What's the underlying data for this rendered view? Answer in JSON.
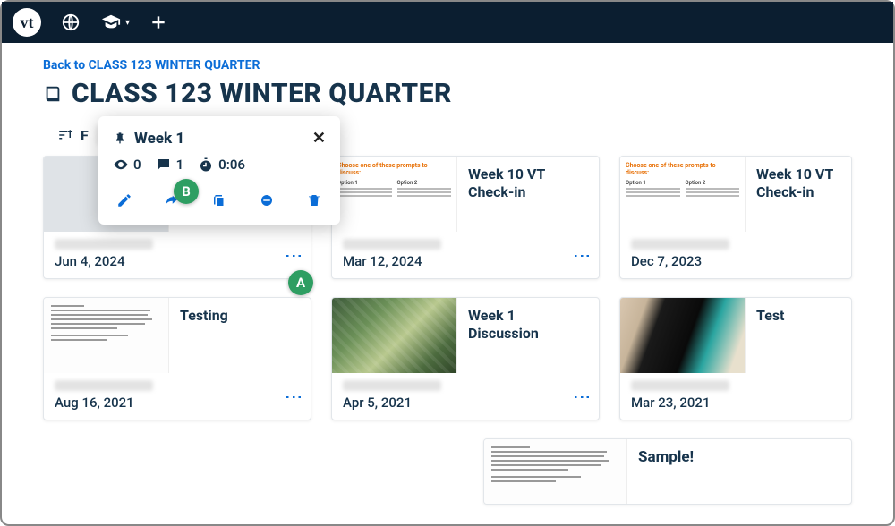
{
  "header": {
    "logo_text": "vt"
  },
  "nav": {
    "back_label": "Back to CLASS 123 WINTER QUARTER"
  },
  "page_title": "CLASS 123 WINTER QUARTER",
  "filter_prefix": "F",
  "popover": {
    "title": "Week 1",
    "views": "0",
    "comments": "1",
    "duration": "0:06"
  },
  "badges": {
    "a": "A",
    "b": "B"
  },
  "cards": [
    {
      "title": "",
      "date": "Jun 4, 2024"
    },
    {
      "title": "Week 10 VT Check-in",
      "date": "Mar 12, 2024",
      "prompt_header": "Choose one of these prompts to discuss:",
      "opt1": "Option 1",
      "opt2": "Option 2"
    },
    {
      "title": "Week 10 VT Check-in",
      "date": "Dec 7, 2023",
      "prompt_header": "Choose one of these prompts to discuss:",
      "opt1": "Option 1",
      "opt2": "Option 2"
    },
    {
      "title": "Testing",
      "date": "Aug 16, 2021"
    },
    {
      "title": "Week 1 Discussion",
      "date": "Apr 5, 2021"
    },
    {
      "title": "Test",
      "date": "Mar 23, 2021"
    },
    {
      "title": "Sample!",
      "date": ""
    }
  ]
}
